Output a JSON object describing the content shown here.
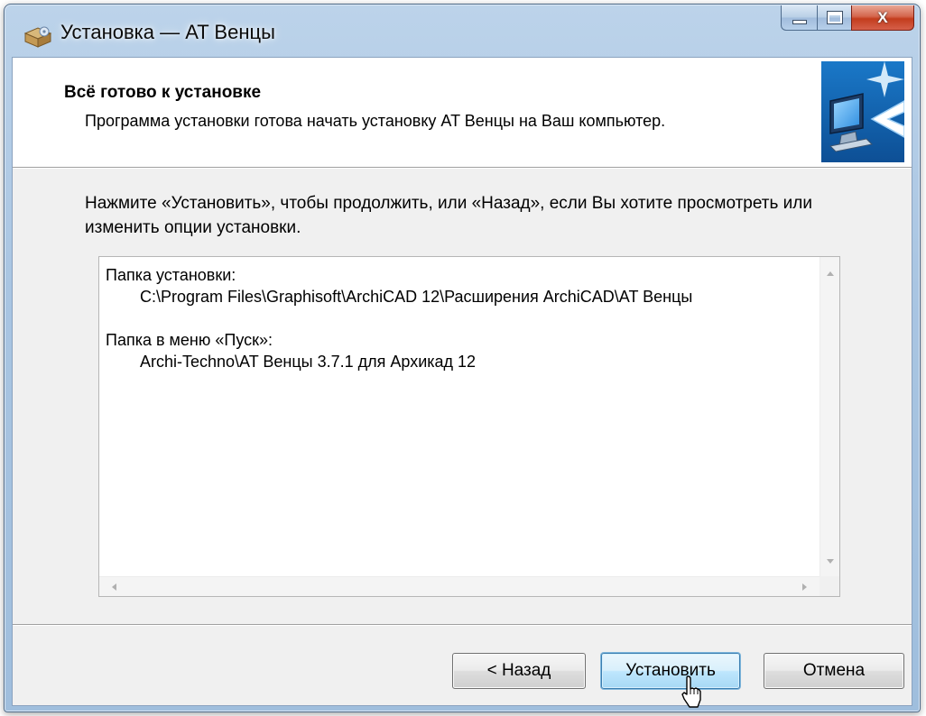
{
  "window": {
    "title": "Установка — AT Венцы",
    "controls": {
      "minimize": "minimize",
      "maximize": "maximize",
      "close": "X"
    }
  },
  "header": {
    "title": "Всё готово к установке",
    "subtitle": "Программа установки готова начать установку AT Венцы на Ваш компьютер."
  },
  "intro_text": "Нажмите «Установить», чтобы продолжить, или «Назад», если Вы хотите просмотреть или изменить опции установки.",
  "memo": {
    "install_folder_label": "Папка установки:",
    "install_folder_value": "C:\\Program Files\\Graphisoft\\ArchiCAD 12\\Расширения ArchiCAD\\AT Венцы",
    "start_menu_label": "Папка в меню «Пуск»:",
    "start_menu_value": "Archi-Techno\\AT Венцы 3.7.1 для Архикад 12"
  },
  "buttons": {
    "back": "< Назад",
    "install": "Установить",
    "cancel": "Отмена"
  },
  "icons": {
    "title_icon": "installer-box-icon",
    "header_image": "computer-install-arrow-icon",
    "cursor": "mouse-pointer-icon"
  },
  "colors": {
    "title_bar": "#a9c5e2",
    "close_button": "#c33c1d",
    "default_button_border": "#3c7fb1",
    "dialog_background": "#f0f0f0"
  }
}
